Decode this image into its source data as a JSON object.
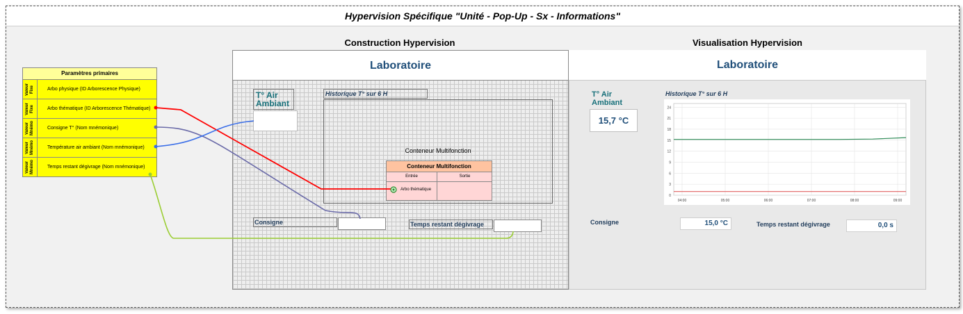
{
  "main_title": "Hypervision Spécifique \"Unité - Pop-Up - Sx - Informations\"",
  "construction_title": "Construction Hypervision",
  "visualisation_title": "Visualisation Hypervision",
  "params": {
    "header": "Paramètres primaires",
    "rows": [
      {
        "tag": "Valeur Fixe",
        "label": "Arbo physique (ID Arborescence Physique)"
      },
      {
        "tag": "Valeur Fixe",
        "label": "Arbo thématique (ID Arborescence Thématique)"
      },
      {
        "tag": "Valeur Mnémo",
        "label": "Consigne T° (Nom mnémonique)"
      },
      {
        "tag": "Valeur Mnémo",
        "label": "Température air ambiant (Nom mnémonique)"
      },
      {
        "tag": "Valeur Mnémo",
        "label": "Temps restant dégivrage (Nom mnémonique)"
      }
    ]
  },
  "construction": {
    "header": "Laboratoire",
    "temp_label": "T° Air Ambiant",
    "history_label": "Historique T° sur 6 H",
    "container_text": "Conteneur Multifonction",
    "container_box": {
      "title": "Conteneur Multifonction",
      "col_in": "Entrée",
      "col_out": "Sortie",
      "input_label": "Arbo thématique"
    },
    "consigne_label": "Consigne",
    "defrost_label": "Temps restant dégivrage"
  },
  "visualisation": {
    "header": "Laboratoire",
    "temp_label": "T° Air Ambiant",
    "temp_value": "15,7 °C",
    "history_label": "Historique T° sur 6 H",
    "consigne_label": "Consigne",
    "consigne_value": "15,0 °C",
    "defrost_label": "Temps restant dégivrage",
    "defrost_value": "0,0 s"
  },
  "chart_data": {
    "type": "line",
    "x_ticks": [
      "04:00",
      "05:00",
      "06:00",
      "07:00",
      "08:00",
      "09:00"
    ],
    "y_ticks": [
      0,
      3,
      6,
      9,
      12,
      15,
      18,
      21,
      24
    ],
    "ylim": [
      0,
      25
    ],
    "series": [
      {
        "color": "#2e8b57",
        "values": [
          15.2,
          15.2,
          15.2,
          15.2,
          15.2,
          15.2,
          15.3,
          15.7
        ]
      },
      {
        "color": "#e06060",
        "values": [
          1,
          1,
          1,
          1,
          1,
          1,
          1,
          1
        ]
      }
    ],
    "grid": true
  },
  "colors": {
    "wire_red": "#ff0000",
    "wire_purple": "#6a6aa8",
    "wire_blue": "#3a6ee8",
    "wire_green": "#9acd32",
    "params_yellow": "#ffff00",
    "header_text": "#1f4e79",
    "teal_text": "#17707a"
  }
}
